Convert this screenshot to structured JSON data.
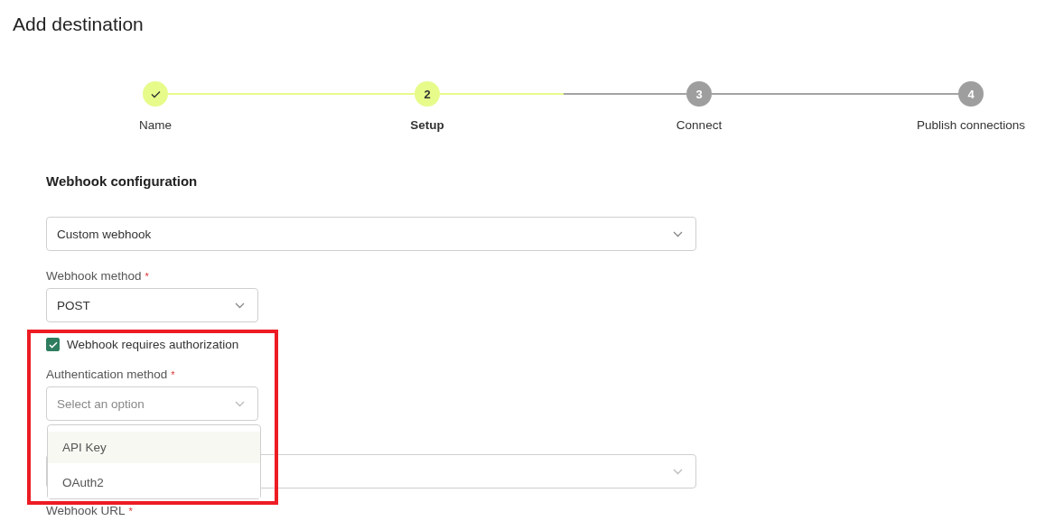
{
  "page_title": "Add destination",
  "steps": [
    {
      "label": "Name",
      "completed": true,
      "selected": false
    },
    {
      "label": "Setup",
      "completed": false,
      "selected": true,
      "number": "2"
    },
    {
      "label": "Connect",
      "completed": false,
      "selected": false,
      "number": "3"
    },
    {
      "label": "Publish connections",
      "completed": false,
      "selected": false,
      "number": "4"
    }
  ],
  "section_title": "Webhook configuration",
  "fields": [
    {
      "kind": "select",
      "wide": true,
      "value": "Custom webhook"
    },
    {
      "kind": "select",
      "wide": false,
      "label": "Webhook method",
      "required_mark": "*",
      "value": "POST"
    },
    {
      "kind": "checkbox",
      "label": "Webhook requires authorization",
      "checked": true
    },
    {
      "kind": "select",
      "wide": false,
      "label": "Authentication method",
      "required_mark": "*",
      "placeholder": "Select an option",
      "open": true,
      "options": [
        {
          "label": "API Key",
          "selected": true
        },
        {
          "label": "OAuth2",
          "selected": false
        }
      ]
    },
    {
      "kind": "select",
      "wide": true
    },
    {
      "kind": "label",
      "label": "Webhook URL",
      "required_mark": "*"
    }
  ],
  "annotation": {
    "kind": "rectangle",
    "color": "#ed1c24"
  }
}
